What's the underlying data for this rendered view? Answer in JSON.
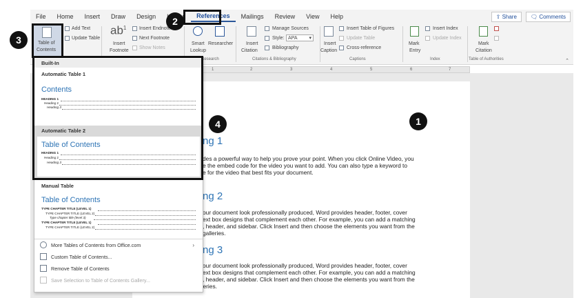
{
  "menu": {
    "tabs": [
      "File",
      "Home",
      "Insert",
      "Draw",
      "Design",
      "Layout",
      "References",
      "Mailings",
      "Review",
      "View",
      "Help"
    ],
    "active_tab": "References",
    "share_label": "Share",
    "comments_label": "Comments"
  },
  "ribbon": {
    "toc": {
      "label_line1": "Table of",
      "label_line2": "Contents"
    },
    "add_text": "Add Text",
    "update_table": "Update Table",
    "insert_footnote_line1": "Insert",
    "insert_footnote_line2": "Footnote",
    "insert_endnote": "Insert Endnote",
    "next_footnote": "Next Footnote",
    "show_notes": "Show Notes",
    "smart_lookup_line1": "Smart",
    "smart_lookup_line2": "Lookup",
    "researcher": "Researcher",
    "research_group": "Research",
    "insert_citation_line1": "Insert",
    "insert_citation_line2": "Citation",
    "manage_sources": "Manage Sources",
    "style_label": "Style:",
    "style_value": "APA",
    "bibliography": "Bibliography",
    "citations_group": "Citations & Bibliography",
    "insert_caption_line1": "Insert",
    "insert_caption_line2": "Caption",
    "insert_table_of_figures": "Insert Table of Figures",
    "update_table_captions": "Update Table",
    "cross_reference": "Cross-reference",
    "captions_group": "Captions",
    "mark_entry_line1": "Mark",
    "mark_entry_line2": "Entry",
    "insert_index": "Insert Index",
    "update_index": "Update Index",
    "index_group": "Index",
    "mark_citation_line1": "Mark",
    "mark_citation_line2": "Citation",
    "authorities_group": "Table of Authorities"
  },
  "ruler": {
    "marks": [
      "1",
      "2",
      "3",
      "4",
      "5",
      "6",
      "7"
    ]
  },
  "dropdown": {
    "built_in": "Built-In",
    "auto1": {
      "name": "Automatic Table 1",
      "title": "Contents",
      "heading1": "HEADING 1",
      "heading2": "Heading 2",
      "heading3": "Heading 3"
    },
    "auto2": {
      "name": "Automatic Table 2",
      "title": "Table of Contents",
      "heading1": "HEADING 1",
      "heading2": "Heading 2",
      "heading3": "Heading 3"
    },
    "manual": {
      "name": "Manual Table",
      "title": "Table of Contents",
      "line1": "TYPE CHAPTER TITLE (LEVEL 1)",
      "line2": "TYPE CHAPTER TITLE (LEVEL 2)",
      "line3": "Type chapter title (level 3)",
      "line4": "TYPE CHAPTER TITLE (LEVEL 1)",
      "line5": "TYPE CHAPTER TITLE (LEVEL 2)"
    },
    "menu_items": [
      {
        "label": "More Tables of Contents from Office.com",
        "icon": "globe-icon",
        "submenu": true
      },
      {
        "label": "Custom Table of Contents...",
        "icon": "document-icon"
      },
      {
        "label": "Remove Table of Contents",
        "icon": "remove-icon"
      },
      {
        "label": "Save Selection to Table of Contents Gallery...",
        "icon": "save-icon",
        "disabled": true
      }
    ]
  },
  "document": {
    "heading1": "ng 1",
    "para1": [
      "des a powerful way to help you prove your point. When you click Online Video, you",
      "e the embed code for the video you want to add. You can also type a keyword to",
      "e for the video that best fits your document."
    ],
    "heading2": "ng 2",
    "para2": [
      "our document look professionally produced, Word provides header, footer, cover",
      "ext box designs that complement each other. For example, you can add a matching",
      ", header, and sidebar. Click Insert and then choose the elements you want from the",
      "galleries."
    ],
    "heading3": "ng 3",
    "para3": [
      "our document look professionally produced, Word provides header, footer, cover",
      "ext box designs that complement each other. For example, you can add a matching",
      ", header, and sidebar. Click Insert and then choose the elements you want from the",
      "different galleries."
    ]
  },
  "annotations": [
    "1",
    "2",
    "3",
    "4"
  ],
  "colors": {
    "accent": "#2b579a",
    "heading": "#2e74b5",
    "annotation": "#111111"
  }
}
